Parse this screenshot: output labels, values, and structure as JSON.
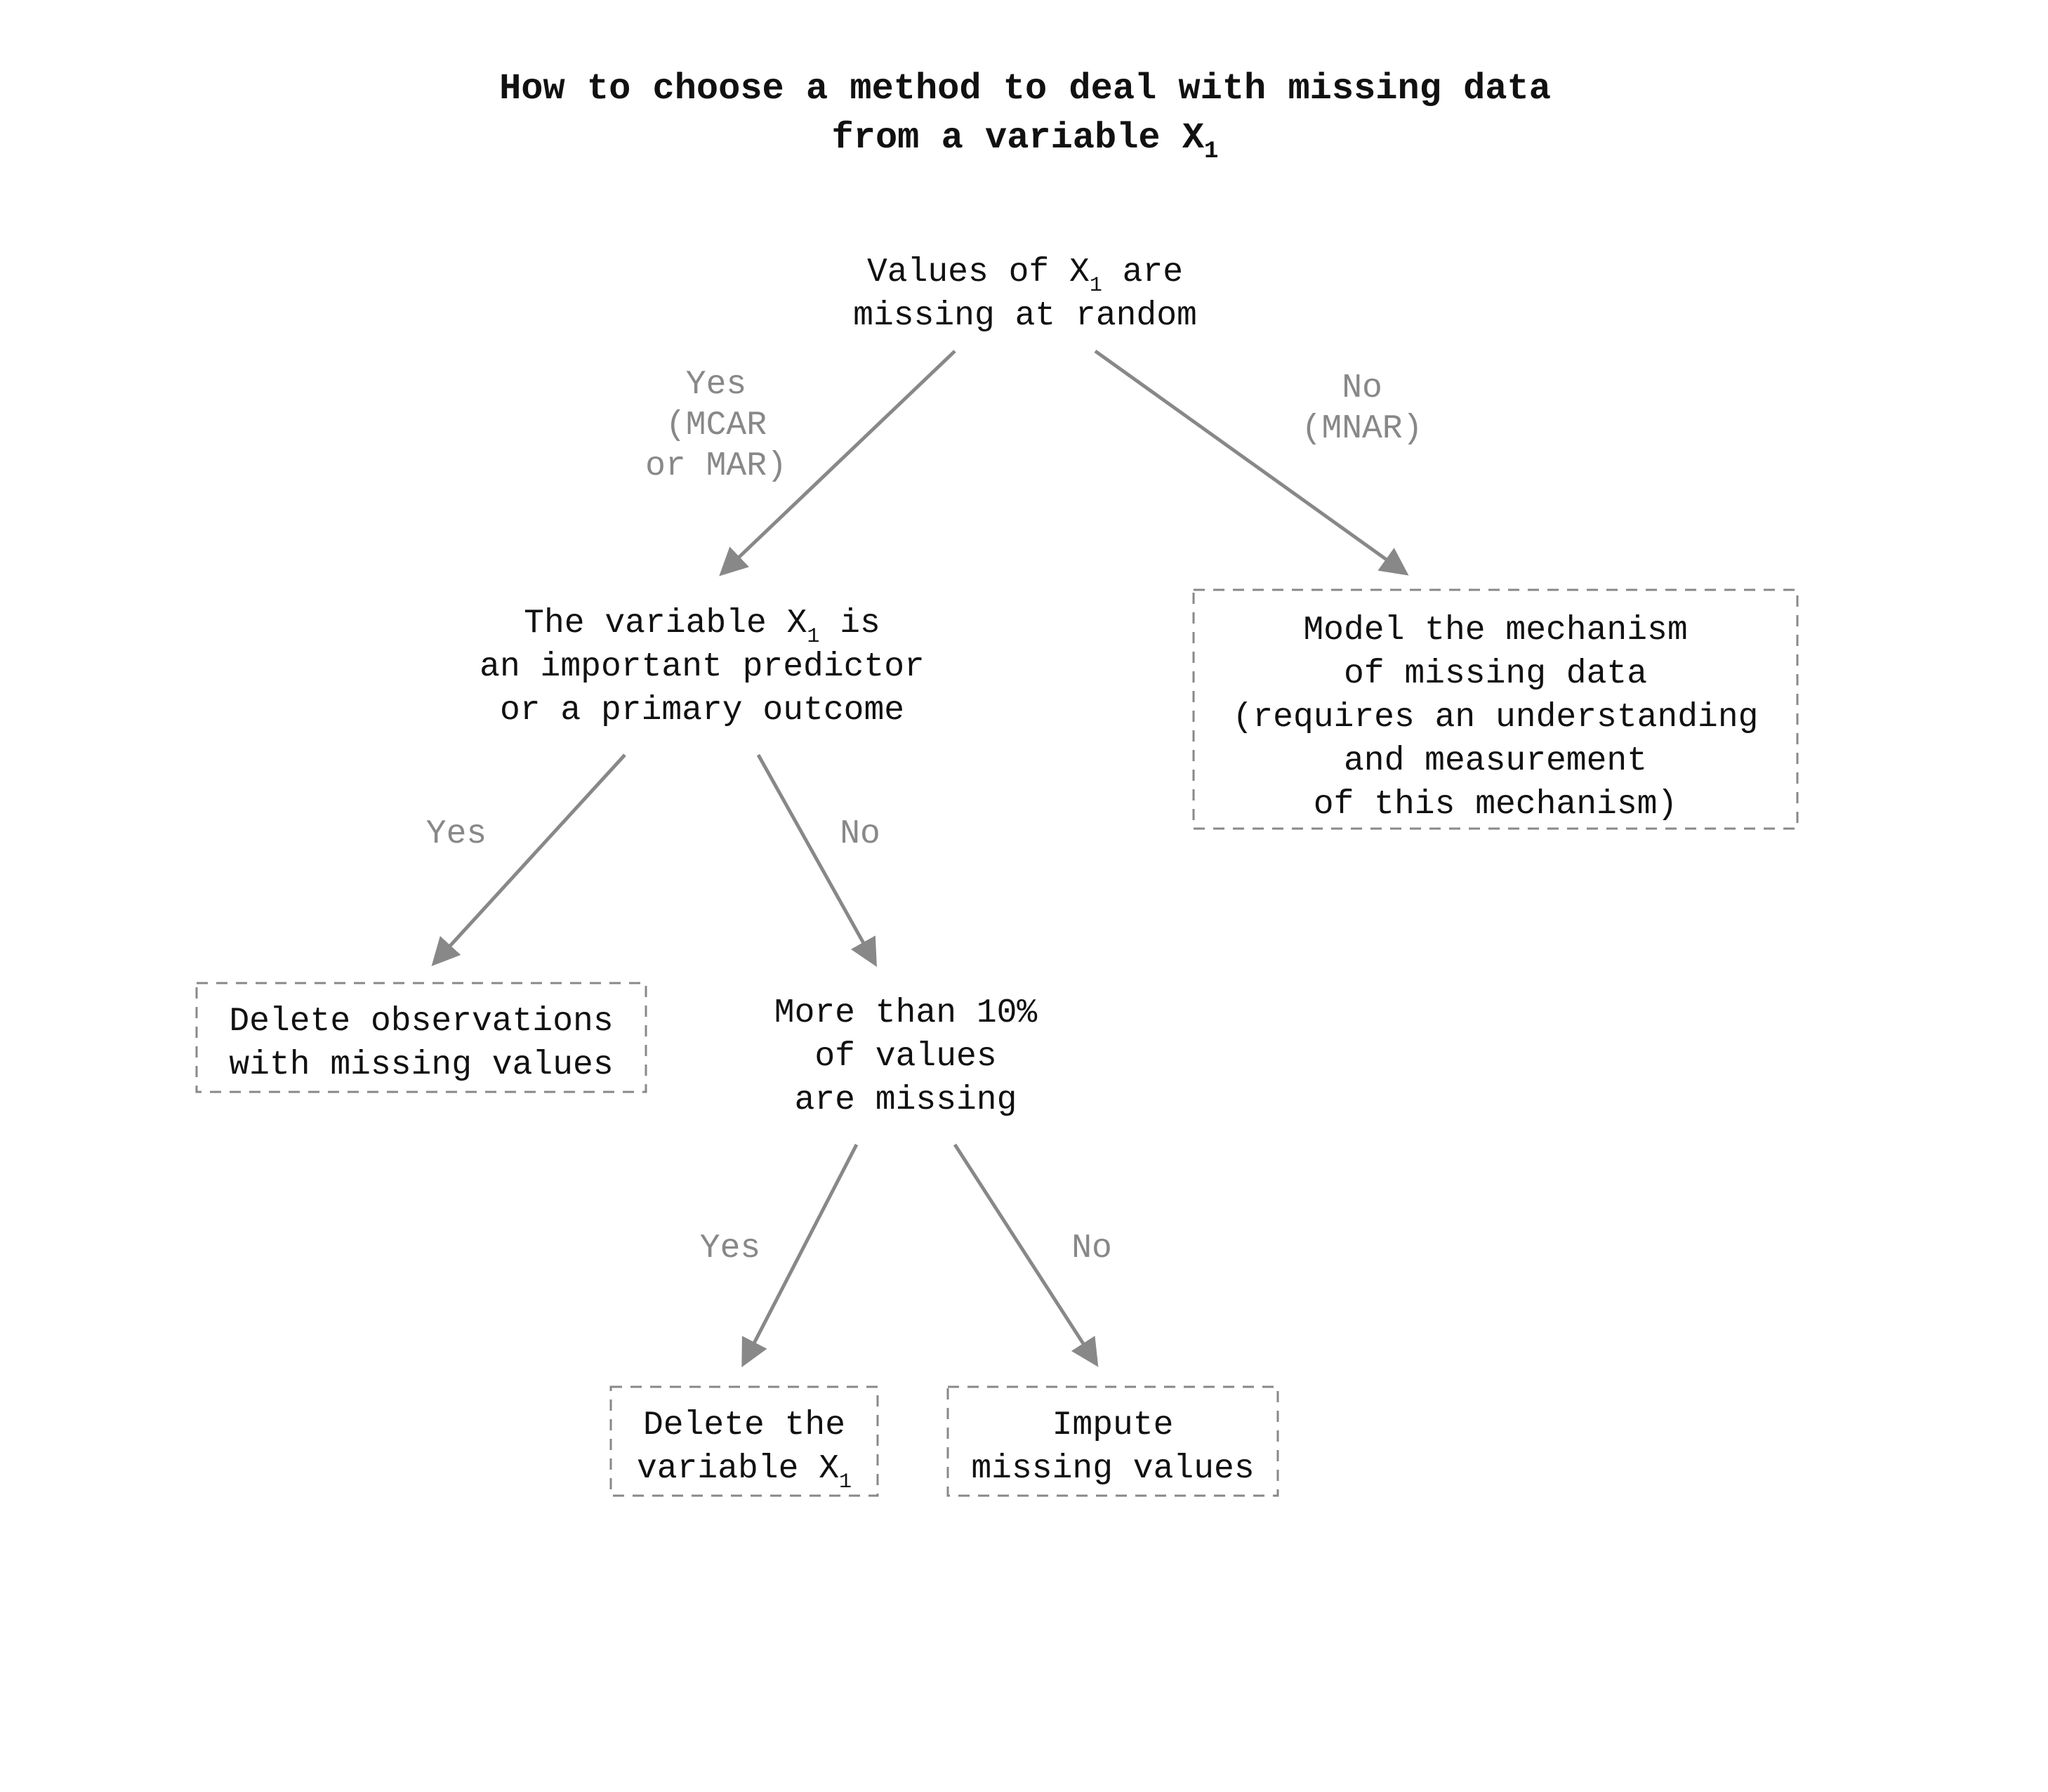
{
  "title": {
    "line1": "How to choose a method to deal with missing data",
    "line2_prefix": "from a variable X",
    "line2_sub": "1"
  },
  "nodes": {
    "root": {
      "line1_prefix": "Values of X",
      "line1_sub": "1",
      "line1_suffix": " are",
      "line2": "missing at random"
    },
    "important": {
      "line1_prefix": "The variable X",
      "line1_sub": "1",
      "line1_suffix": " is",
      "line2": "an important predictor",
      "line3": "or a primary outcome"
    },
    "model": {
      "line1": "Model the mechanism",
      "line2": "of missing data",
      "line3": "(requires an understanding",
      "line4": "and measurement",
      "line5": "of this mechanism)"
    },
    "delete_obs": {
      "line1": "Delete observations",
      "line2": "with missing values"
    },
    "more10": {
      "line1": "More than 10%",
      "line2": "of values",
      "line3": "are missing"
    },
    "delete_var": {
      "line1": "Delete the",
      "line2_prefix": "variable X",
      "line2_sub": "1"
    },
    "impute": {
      "line1": "Impute",
      "line2": "missing values"
    }
  },
  "edges": {
    "root_yes": {
      "line1": "Yes",
      "line2": "(MCAR",
      "line3": "or MAR)"
    },
    "root_no": {
      "line1": "No",
      "line2": "(MNAR)"
    },
    "imp_yes": "Yes",
    "imp_no": "No",
    "ten_yes": "Yes",
    "ten_no": "No"
  }
}
